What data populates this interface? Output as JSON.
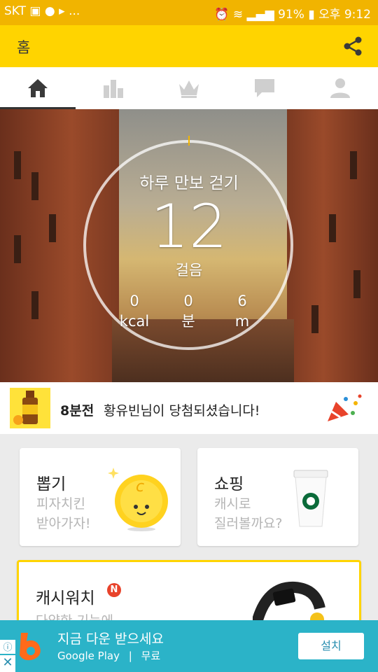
{
  "status_bar": {
    "carrier": "SKT",
    "icons_left": [
      "image-icon",
      "chat-icon",
      "app-icon",
      "more-icon"
    ],
    "more": "...",
    "icons_right": [
      "alarm-icon",
      "wifi-icon",
      "signal-icon",
      "battery-icon"
    ],
    "battery": "91%",
    "time": "오후 9:12"
  },
  "app_bar": {
    "title": "홈"
  },
  "tabs": [
    {
      "icon": "home-icon",
      "active": true
    },
    {
      "icon": "bar-chart-icon",
      "active": false
    },
    {
      "icon": "crown-icon",
      "active": false
    },
    {
      "icon": "message-icon",
      "active": false
    },
    {
      "icon": "person-icon",
      "active": false
    }
  ],
  "hero": {
    "title": "하루 만보 걷기",
    "steps": "12",
    "steps_unit": "걸음",
    "stats": [
      {
        "value": "0",
        "unit": "kcal"
      },
      {
        "value": "0",
        "unit": "분"
      },
      {
        "value": "6",
        "unit": "m"
      }
    ],
    "progress_fraction": 0.0012
  },
  "notice": {
    "time": "8분전",
    "message": "황유빈님이 당첨되셨습니다!"
  },
  "cards": {
    "draw": {
      "title": "뽑기",
      "subtitle_line1": "피자치킨",
      "subtitle_line2": "받아가자!"
    },
    "shopping": {
      "title": "쇼핑",
      "subtitle_line1": "캐시로",
      "subtitle_line2": "질러볼까요?"
    },
    "cashwatch": {
      "title": "캐시워치",
      "badge": "N",
      "subtitle": "다양한 기능에"
    }
  },
  "ad": {
    "headline": "지금 다운 받으세요",
    "store": "Google Play",
    "separator": "|",
    "price": "무료",
    "install": "설치"
  },
  "colors": {
    "accent": "#ffd400",
    "status": "#f1b400",
    "ad": "#2bb3c8"
  }
}
